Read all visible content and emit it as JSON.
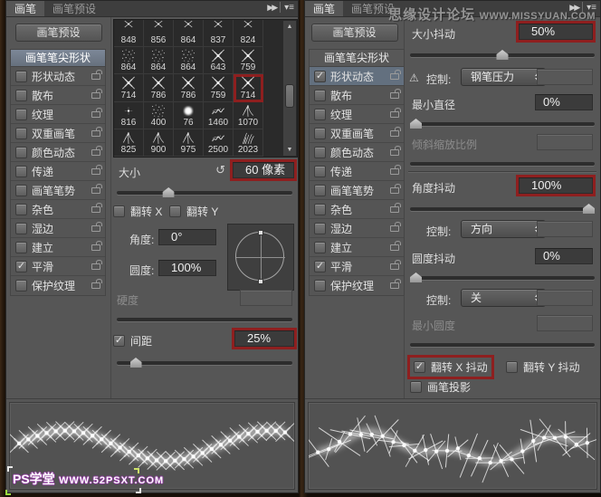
{
  "icons": {
    "collapse": "▶▶",
    "menu": "▾≡",
    "reset": "↺",
    "check": "✓",
    "warning": "⚠",
    "scroll_up": "▲",
    "scroll_down": "▼"
  },
  "colors": {
    "annotation_red": "#8e1f1f",
    "selection_blue": "#63707f",
    "panel_bg": "#565656",
    "field_bg": "#3b3b3b",
    "grid_bg": "#2a2a2a"
  },
  "watermark_top": {
    "site_name": "思缘设计论坛",
    "site_url": "www.missyuan.com"
  },
  "watermark_bottom": {
    "site_name": "PS学堂",
    "site_url": "www.52psxt.com"
  },
  "left_panel": {
    "tabs": [
      {
        "label": "画笔",
        "active": true
      },
      {
        "label": "画笔预设",
        "active": false
      }
    ],
    "preset_button": "画笔预设",
    "tip_shape_button": {
      "label": "画笔笔尖形状",
      "selected": true
    },
    "sidebar_items": [
      {
        "label": "形状动态",
        "checked": false,
        "selected": false
      },
      {
        "label": "散布",
        "checked": false,
        "selected": false
      },
      {
        "label": "纹理",
        "checked": false,
        "selected": false
      },
      {
        "label": "双重画笔",
        "checked": false,
        "selected": false
      },
      {
        "label": "颜色动态",
        "checked": false,
        "selected": false
      },
      {
        "label": "传递",
        "checked": false,
        "selected": false
      },
      {
        "label": "画笔笔势",
        "checked": false,
        "selected": false
      },
      {
        "label": "杂色",
        "checked": false,
        "selected": false
      },
      {
        "label": "湿边",
        "checked": false,
        "selected": false
      },
      {
        "label": "建立",
        "checked": false,
        "selected": false
      },
      {
        "label": "平滑",
        "checked": true,
        "selected": false
      },
      {
        "label": "保护纹理",
        "checked": false,
        "selected": false
      }
    ],
    "brush_grid": {
      "cells": [
        {
          "size": "848",
          "icon": "spark-top"
        },
        {
          "size": "856",
          "icon": "spark-top"
        },
        {
          "size": "864",
          "icon": "spark-top"
        },
        {
          "size": "837",
          "icon": "spark-top"
        },
        {
          "size": "824",
          "icon": "spark-top"
        },
        {
          "size": "864",
          "icon": "speck"
        },
        {
          "size": "864",
          "icon": "speck"
        },
        {
          "size": "864",
          "icon": "speck"
        },
        {
          "size": "643",
          "icon": "star"
        },
        {
          "size": "759",
          "icon": "star"
        },
        {
          "size": "714",
          "icon": "star"
        },
        {
          "size": "786",
          "icon": "star"
        },
        {
          "size": "786",
          "icon": "star"
        },
        {
          "size": "759",
          "icon": "star"
        },
        {
          "size": "714",
          "icon": "star",
          "selected": true,
          "annotated": true
        },
        {
          "size": "816",
          "icon": "dot"
        },
        {
          "size": "400",
          "icon": "speck"
        },
        {
          "size": "76",
          "icon": "soft"
        },
        {
          "size": "1460",
          "icon": "scribble"
        },
        {
          "size": "1070",
          "icon": "wing"
        },
        {
          "size": "825",
          "icon": "wing"
        },
        {
          "size": "900",
          "icon": "wing"
        },
        {
          "size": "975",
          "icon": "wing"
        },
        {
          "size": "2500",
          "icon": "scribble"
        },
        {
          "size": "2023",
          "icon": "grass"
        }
      ]
    },
    "size": {
      "label": "大小",
      "value": "60 像素",
      "slider_percent": 28,
      "annotated": true
    },
    "flip_x": {
      "label": "翻转 X",
      "checked": false
    },
    "flip_y": {
      "label": "翻转 Y",
      "checked": false
    },
    "angle": {
      "label": "角度:",
      "value": "0°"
    },
    "roundness": {
      "label": "圆度:",
      "value": "100%"
    },
    "hardness": {
      "label": "硬度",
      "disabled": true
    },
    "spacing": {
      "label": "间距",
      "checked": true,
      "value": "25%",
      "slider_percent": 8,
      "annotated": true
    }
  },
  "right_panel": {
    "tabs": [
      {
        "label": "画笔",
        "active": true
      },
      {
        "label": "画笔预设",
        "active": false
      }
    ],
    "preset_button": "画笔预设",
    "tip_shape_button": {
      "label": "画笔笔尖形状",
      "selected": false
    },
    "sidebar_items": [
      {
        "label": "形状动态",
        "checked": true,
        "selected": true
      },
      {
        "label": "散布",
        "checked": false,
        "selected": false
      },
      {
        "label": "纹理",
        "checked": false,
        "selected": false
      },
      {
        "label": "双重画笔",
        "checked": false,
        "selected": false
      },
      {
        "label": "颜色动态",
        "checked": false,
        "selected": false
      },
      {
        "label": "传递",
        "checked": false,
        "selected": false
      },
      {
        "label": "画笔笔势",
        "checked": false,
        "selected": false
      },
      {
        "label": "杂色",
        "checked": false,
        "selected": false
      },
      {
        "label": "湿边",
        "checked": false,
        "selected": false
      },
      {
        "label": "建立",
        "checked": false,
        "selected": false
      },
      {
        "label": "平滑",
        "checked": true,
        "selected": false
      },
      {
        "label": "保护纹理",
        "checked": false,
        "selected": false
      }
    ],
    "size_jitter": {
      "label": "大小抖动",
      "value": "50%",
      "slider_percent": 50,
      "annotated": true
    },
    "control_size": {
      "label": "控制:",
      "value": "钢笔压力",
      "annotated": true
    },
    "min_diameter": {
      "label": "最小直径",
      "value": "0%",
      "slider_percent": 0
    },
    "tilt_scale": {
      "label": "倾斜缩放比例",
      "disabled": true
    },
    "angle_jitter": {
      "label": "角度抖动",
      "value": "100%",
      "slider_percent": 100,
      "annotated": true
    },
    "control_angle": {
      "label": "控制:",
      "value": "方向",
      "annotated": true
    },
    "roundness_jitter": {
      "label": "圆度抖动",
      "value": "0%",
      "slider_percent": 0
    },
    "control_roundness": {
      "label": "控制:",
      "value": "关"
    },
    "min_roundness": {
      "label": "最小圆度",
      "disabled": true
    },
    "flip_x_jitter": {
      "label": "翻转 X 抖动",
      "checked": true,
      "annotated": true
    },
    "flip_y_jitter": {
      "label": "翻转 Y 抖动",
      "checked": false
    },
    "brush_projection": {
      "label": "画笔投影",
      "checked": false
    }
  },
  "previews": {
    "left": {
      "style": "uniform",
      "marks": 30
    },
    "right": {
      "style": "jitter",
      "marks": 26
    }
  }
}
